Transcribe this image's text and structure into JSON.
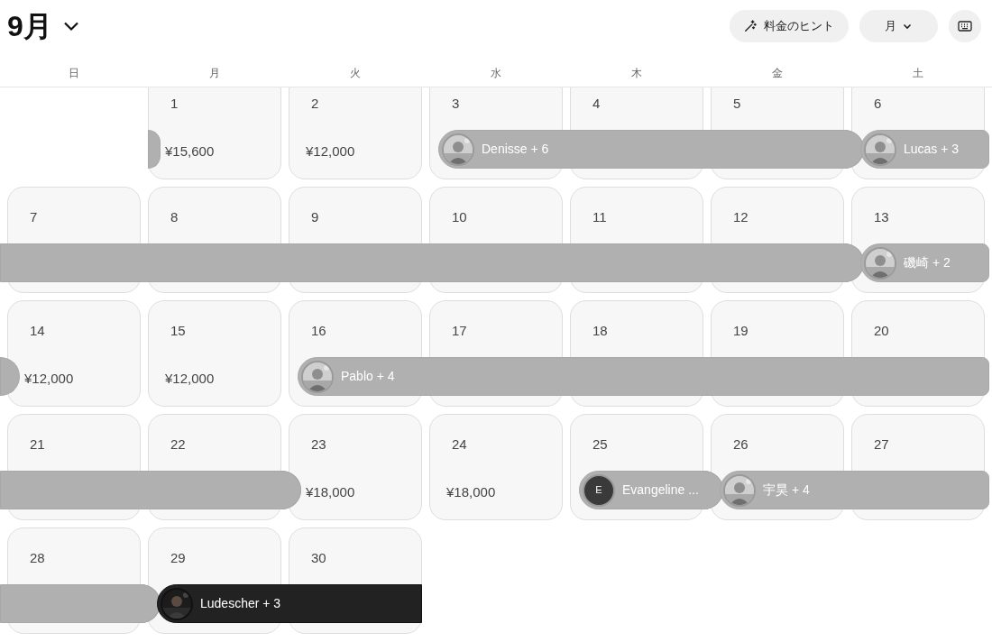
{
  "header": {
    "title": "9月",
    "buttons": [
      {
        "kind": "hint",
        "label": "料金のヒント"
      },
      {
        "kind": "view",
        "label": "月"
      },
      {
        "kind": "keyboard"
      }
    ]
  },
  "weekdays": [
    "日",
    "月",
    "火",
    "水",
    "木",
    "金",
    "土"
  ],
  "weeks": [
    {
      "carry_in": true,
      "days": [
        {
          "kind": "blank"
        },
        {
          "kind": "day",
          "date": "1",
          "checkout": true,
          "price": "¥15,600"
        },
        {
          "kind": "day",
          "date": "2",
          "price": "¥12,000"
        },
        {
          "kind": "day",
          "date": "3",
          "stay": {
            "guest": "Denisse + 6",
            "selected": false
          }
        },
        {
          "kind": "day",
          "date": "4"
        },
        {
          "kind": "day",
          "date": "5"
        },
        {
          "kind": "day",
          "date": "6",
          "checkout": true,
          "stay": {
            "guest": "Lucas + 3",
            "selected": false
          }
        }
      ]
    },
    {
      "carry_in": true,
      "days": [
        {
          "kind": "day",
          "date": "7"
        },
        {
          "kind": "day",
          "date": "8"
        },
        {
          "kind": "day",
          "date": "9"
        },
        {
          "kind": "day",
          "date": "10"
        },
        {
          "kind": "day",
          "date": "11"
        },
        {
          "kind": "day",
          "date": "12"
        },
        {
          "kind": "day",
          "date": "13",
          "checkout": true,
          "stay": {
            "guest": "磯崎 + 2",
            "selected": false
          }
        }
      ]
    },
    {
      "carry_in": true,
      "days": [
        {
          "kind": "day",
          "date": "14",
          "checkout": true,
          "price": "¥12,000"
        },
        {
          "kind": "day",
          "date": "15",
          "price": "¥12,000"
        },
        {
          "kind": "day",
          "date": "16",
          "stay": {
            "guest": "Pablo + 4",
            "selected": false
          }
        },
        {
          "kind": "day",
          "date": "17"
        },
        {
          "kind": "day",
          "date": "18"
        },
        {
          "kind": "day",
          "date": "19"
        },
        {
          "kind": "day",
          "date": "20"
        }
      ]
    },
    {
      "carry_in": true,
      "days": [
        {
          "kind": "day",
          "date": "21"
        },
        {
          "kind": "day",
          "date": "22"
        },
        {
          "kind": "day",
          "date": "23",
          "checkout": true,
          "price": "¥18,000"
        },
        {
          "kind": "day",
          "date": "24",
          "price": "¥18,000"
        },
        {
          "kind": "day",
          "date": "25",
          "stay": {
            "guest": "Evangeline ...",
            "avatar": {
              "kind": "initial",
              "text": "E"
            },
            "selected": false
          }
        },
        {
          "kind": "day",
          "date": "26",
          "checkout": true,
          "stay": {
            "guest": "宇昊 + 4",
            "selected": false
          }
        },
        {
          "kind": "day",
          "date": "27"
        }
      ]
    },
    {
      "carry_in": true,
      "days": [
        {
          "kind": "day",
          "date": "28"
        },
        {
          "kind": "day",
          "date": "29",
          "checkout": true,
          "stay": {
            "guest": "Ludescher + 3",
            "selected": true
          }
        },
        {
          "kind": "day",
          "date": "30"
        }
      ]
    }
  ]
}
